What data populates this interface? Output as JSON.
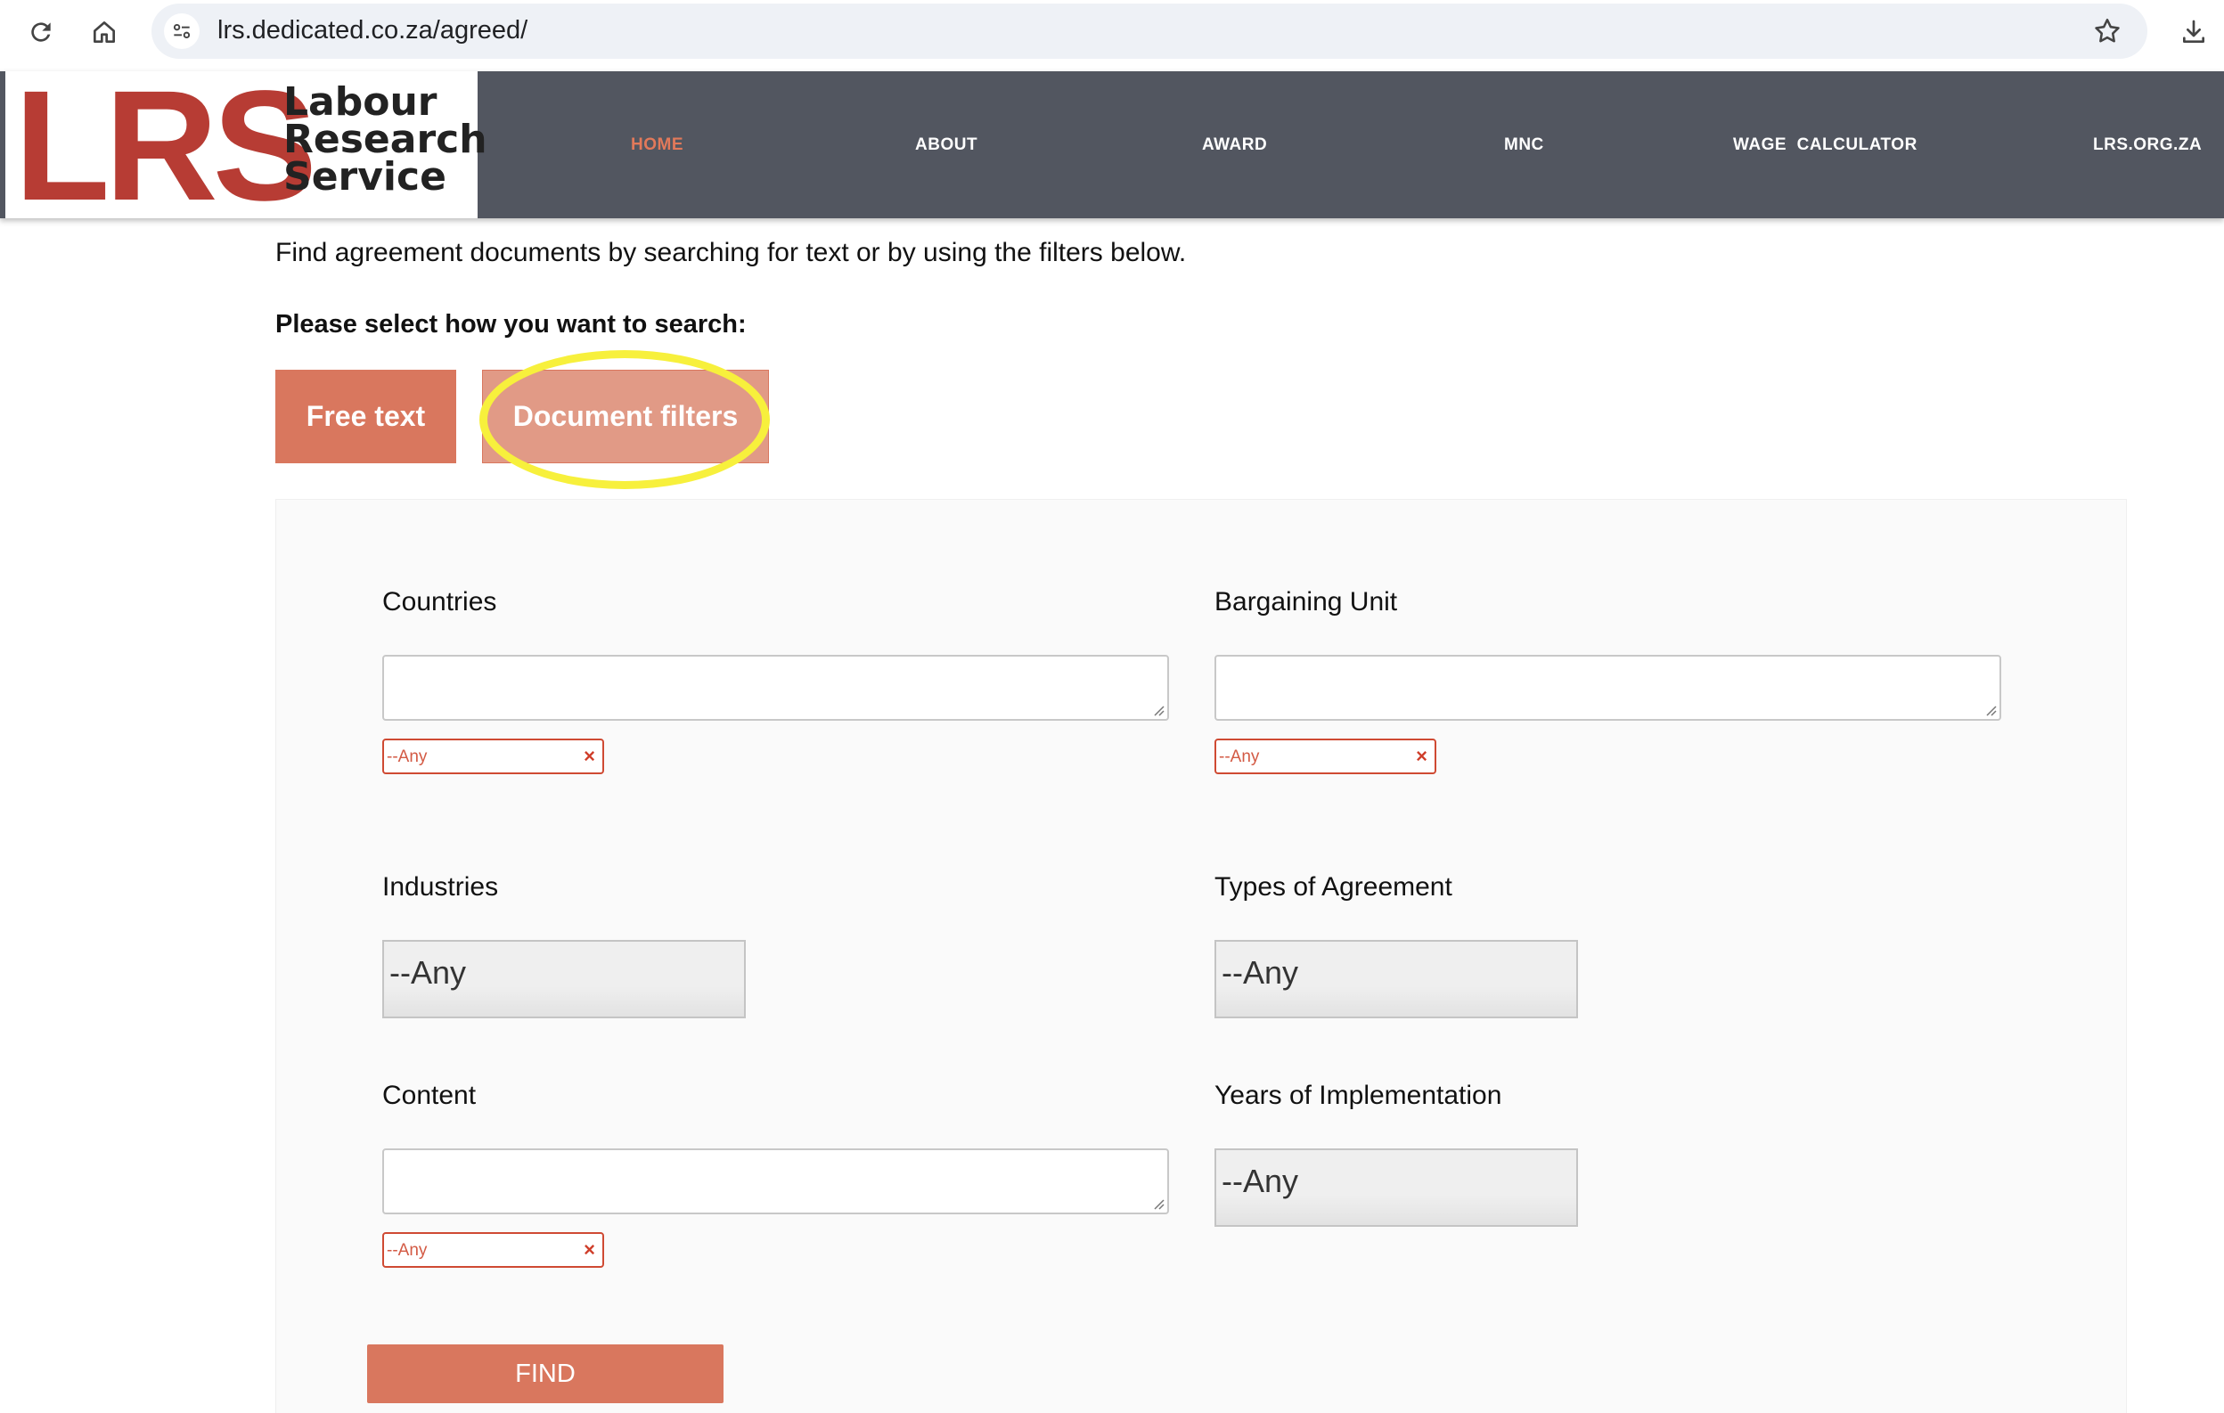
{
  "browser": {
    "url": "lrs.dedicated.co.za/agreed/"
  },
  "logo": {
    "acronym": "LRS",
    "line1": "Labour",
    "line2": "Research",
    "line3": "Service"
  },
  "nav": {
    "items": [
      {
        "label": "HOME",
        "active": true
      },
      {
        "label": "ABOUT",
        "active": false
      },
      {
        "label": "AWARD",
        "active": false
      },
      {
        "label": "MNC",
        "active": false
      },
      {
        "label": "WAGE  CALCULATOR",
        "active": false
      },
      {
        "label": "LRS.ORG.ZA",
        "active": false
      }
    ]
  },
  "page": {
    "intro": "Find agreement documents by searching for text or by using the filters below.",
    "prompt": "Please select how you want to search:",
    "free_text_button": "Free text",
    "document_filters_button": "Document filters"
  },
  "filters": {
    "countries": {
      "label": "Countries",
      "chip": "--Any",
      "chip_remove": "×"
    },
    "bargaining_unit": {
      "label": "Bargaining Unit",
      "chip": "--Any",
      "chip_remove": "×"
    },
    "industries": {
      "label": "Industries",
      "value": "--Any"
    },
    "types_of_agreement": {
      "label": "Types of Agreement",
      "value": "--Any"
    },
    "content": {
      "label": "Content",
      "chip": "--Any",
      "chip_remove": "×"
    },
    "years_of_implementation": {
      "label": "Years of Implementation",
      "value": "--Any"
    }
  },
  "find_button": "FIND",
  "colors": {
    "accent": "#d9775e",
    "header_bg": "#525660",
    "logo_red": "#b73c34",
    "highlight": "#f7f03c"
  }
}
